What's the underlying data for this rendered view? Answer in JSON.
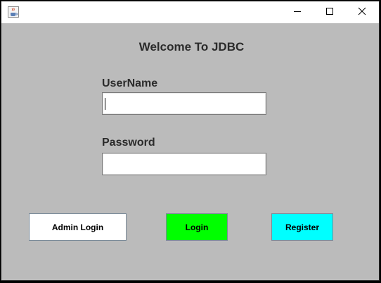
{
  "window": {
    "icon": "java-coffee-icon",
    "controls": {
      "minimize_icon": "minimize-icon",
      "maximize_icon": "maximize-icon",
      "close_icon": "close-icon"
    }
  },
  "form": {
    "heading": "Welcome To JDBC",
    "username_label": "UserName",
    "username_value": "",
    "password_label": "Password",
    "password_value": ""
  },
  "buttons": {
    "admin_login": "Admin Login",
    "login": "Login",
    "register": "Register"
  },
  "colors": {
    "background": "#bbbbbb",
    "login_button": "#00ff00",
    "register_button": "#00ffff",
    "admin_button": "#ffffff"
  }
}
